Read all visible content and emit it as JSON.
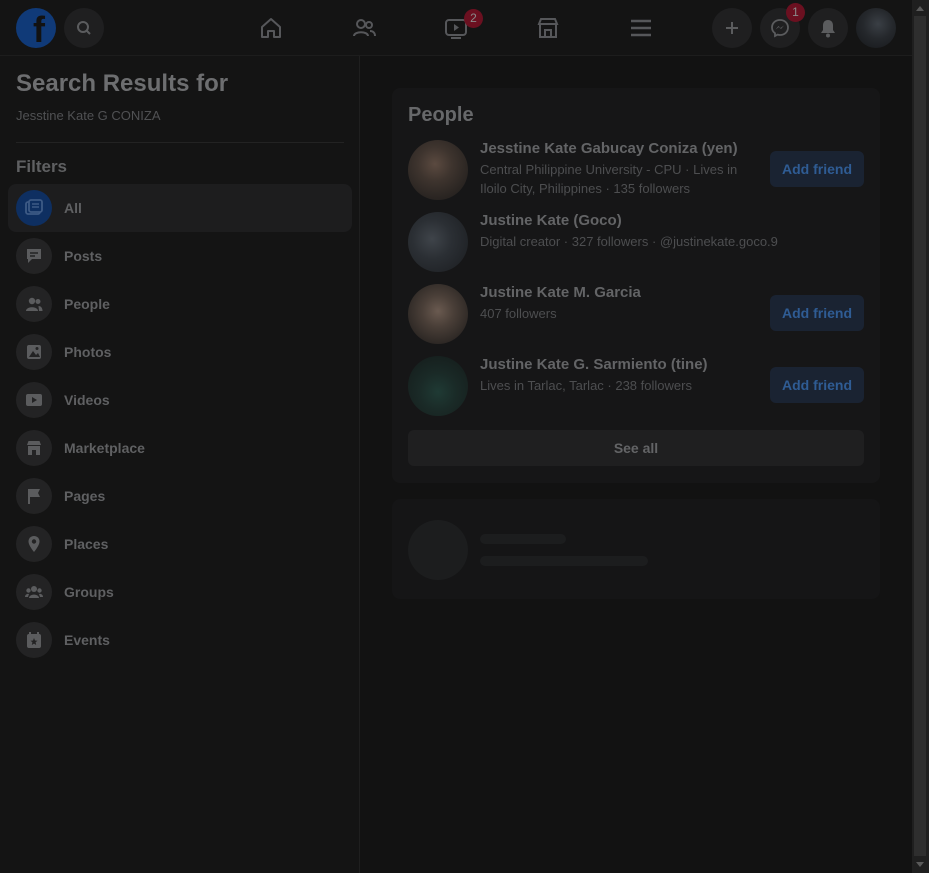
{
  "topbar": {
    "logo_letter": "f",
    "icons": {
      "search": "search-icon",
      "home": "home-icon",
      "friends": "friends-icon",
      "watch": "watch-icon",
      "marketplace": "marketplace-icon",
      "menu": "menu-icon",
      "create": "plus-icon",
      "messenger": "messenger-icon",
      "notifications": "bell-icon"
    },
    "watch_badge": "2",
    "messenger_badge": "1"
  },
  "sidebar": {
    "title": "Search Results for",
    "query": "Jesstine Kate G CONIZA",
    "filters_heading": "Filters",
    "items": [
      {
        "label": "All",
        "icon": "all-results-icon"
      },
      {
        "label": "Posts",
        "icon": "posts-icon"
      },
      {
        "label": "People",
        "icon": "people-icon"
      },
      {
        "label": "Photos",
        "icon": "photos-icon"
      },
      {
        "label": "Videos",
        "icon": "videos-icon"
      },
      {
        "label": "Marketplace",
        "icon": "marketplace-icon"
      },
      {
        "label": "Pages",
        "icon": "flag-icon"
      },
      {
        "label": "Places",
        "icon": "location-pin-icon"
      },
      {
        "label": "Groups",
        "icon": "groups-icon"
      },
      {
        "label": "Events",
        "icon": "calendar-star-icon"
      }
    ]
  },
  "people": {
    "title": "People",
    "results": [
      {
        "name": "Jesstine Kate Gabucay Coniza (yen)",
        "info": "Central Philippine University - CPU · Lives in Iloilo City, Philippines · 135 followers",
        "action": "Add friend"
      },
      {
        "name": "Justine Kate (Goco)",
        "info": "Digital creator · 327 followers · @justinekate.goco.9",
        "action": ""
      },
      {
        "name": "Justine Kate M. Garcia",
        "info": "407 followers",
        "action": "Add friend"
      },
      {
        "name": "Justine Kate G. Sarmiento (tine)",
        "info": "Lives in Tarlac, Tarlac · 238 followers",
        "action": "Add friend"
      }
    ],
    "see_all": "See all"
  },
  "colors": {
    "accent": "#1877f2",
    "badge": "#e41e3f",
    "dim_overlay": "#121212"
  }
}
